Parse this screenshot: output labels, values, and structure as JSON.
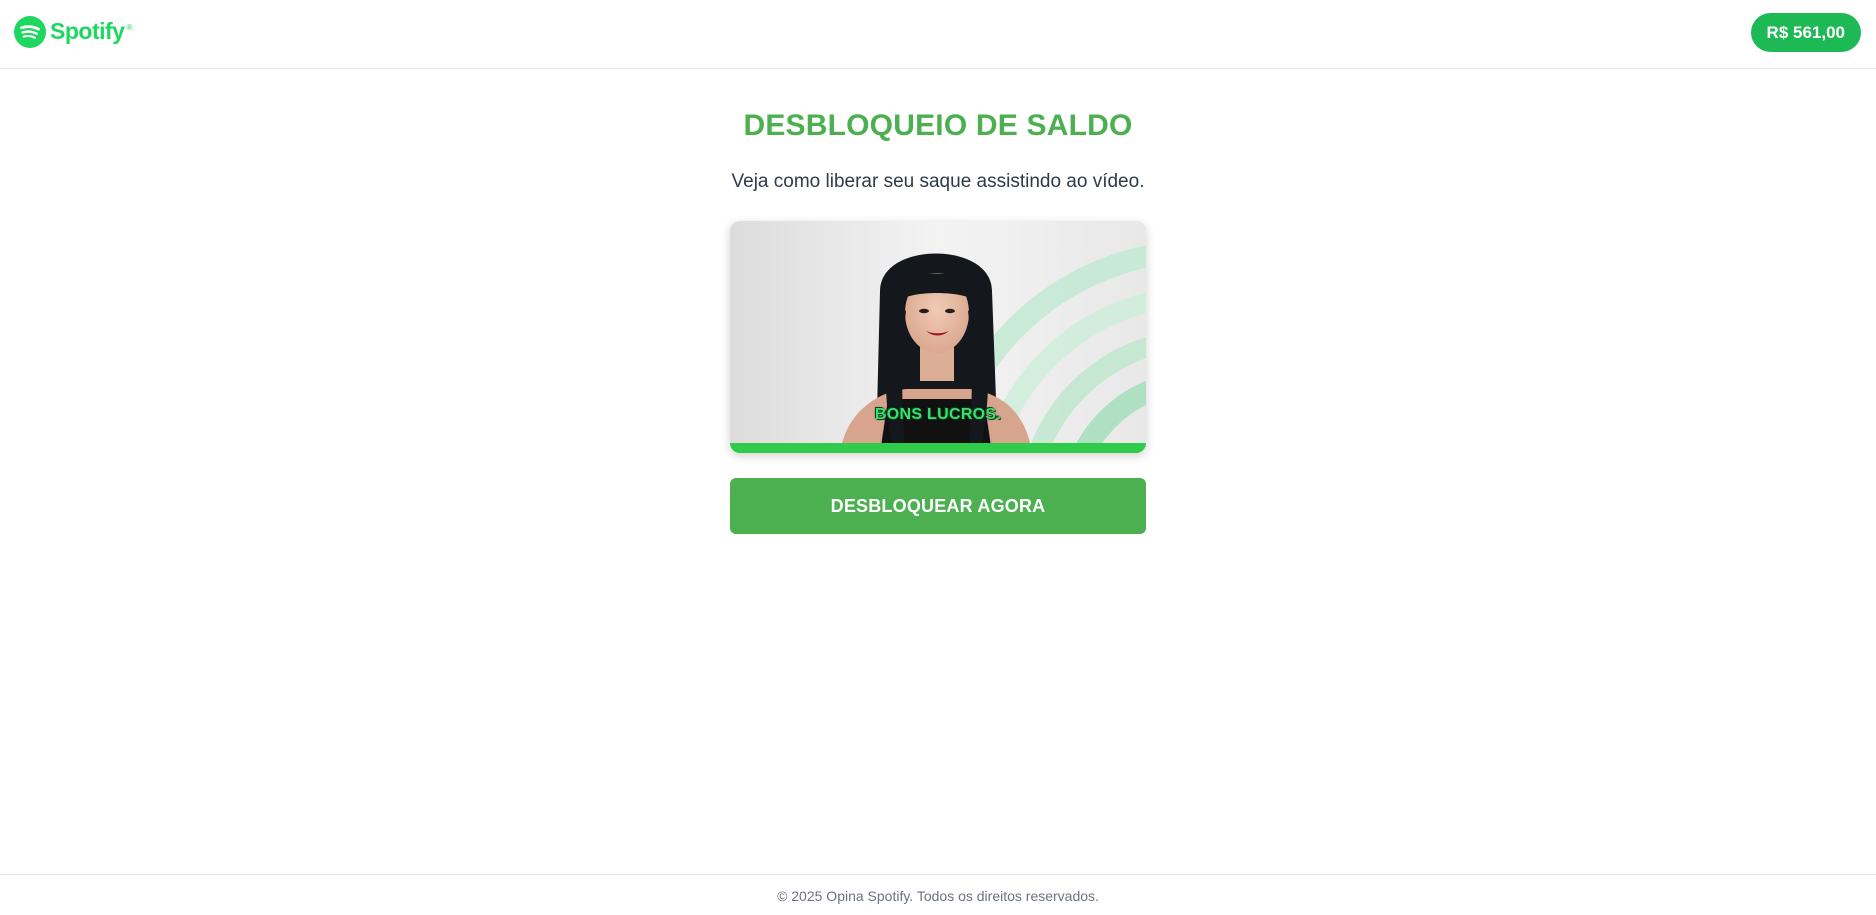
{
  "header": {
    "logo_text": "Spotify",
    "logo_icon": "spotify-logo-icon",
    "balance_label": "R$ 561,00"
  },
  "main": {
    "title": "DESBLOQUEIO DE SALDO",
    "subtitle": "Veja como liberar seu saque assistindo ao vídeo.",
    "video": {
      "caption": "BONS LUCROS.",
      "progress": 0.0
    },
    "cta_label": "DESBLOQUEAR AGORA"
  },
  "footer": {
    "text": "© 2025 Opina Spotify. Todos os direitos reservados."
  },
  "colors": {
    "brand_green": "#1db954",
    "title_green": "#4caf50",
    "logo_green": "#1ed760",
    "text_dark": "#2f3a4a",
    "footer_gray": "#6b7280"
  }
}
